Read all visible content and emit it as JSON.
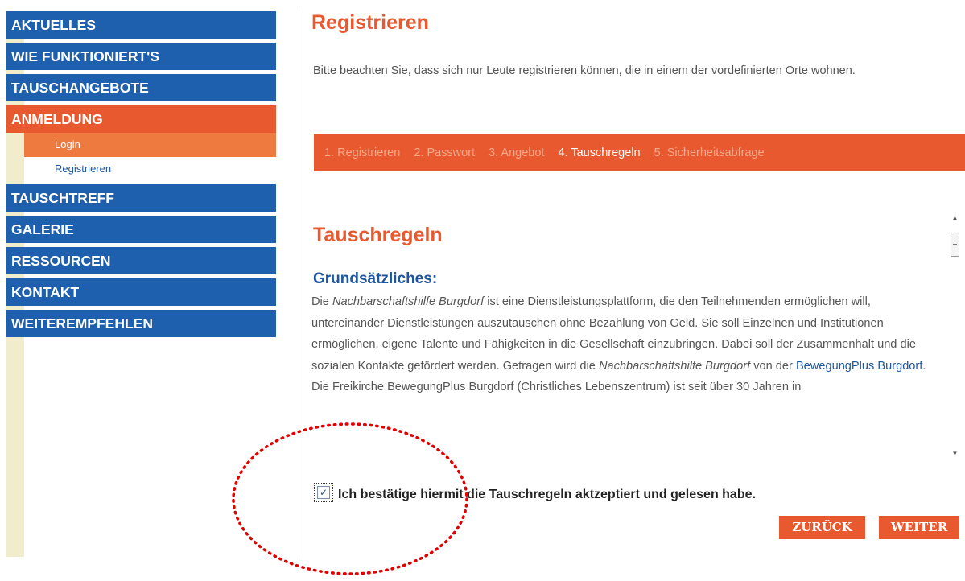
{
  "sidebar": {
    "items": [
      {
        "label": "AKTUELLES"
      },
      {
        "label": "WIE FUNKTIONIERT'S"
      },
      {
        "label": "TAUSCHANGEBOTE"
      },
      {
        "label": "ANMELDUNG"
      },
      {
        "label": "TAUSCHTREFF"
      },
      {
        "label": "GALERIE"
      },
      {
        "label": "RESSOURCEN"
      },
      {
        "label": "KONTAKT"
      },
      {
        "label": "WEITEREMPFEHLEN"
      }
    ],
    "subitems": [
      {
        "label": "Login"
      },
      {
        "label": "Registrieren"
      }
    ]
  },
  "main": {
    "title": "Registrieren",
    "intro": "Bitte beachten Sie, dass sich nur Leute registrieren können, die in einem der vordefinierten Orte wohnen.",
    "steps": [
      {
        "label": "1. Registrieren"
      },
      {
        "label": "2. Passwort"
      },
      {
        "label": "3. Angebot"
      },
      {
        "label": "4. Tauschregeln"
      },
      {
        "label": "5. Sicherheitsabfrage"
      }
    ]
  },
  "rules": {
    "heading": "Tauschregeln",
    "subheading": "Grundsätzliches:",
    "p1": "Die ",
    "p1_em": "Nachbarschaftshilfe Burgdorf",
    "p2": " ist eine Dienstleistungsplattform, die den Teilnehmenden ermöglichen will, untereinander Dienstleistungen auszutauschen ohne Bezahlung von Geld. Sie soll Einzelnen und Institutionen ermöglichen, eigene Talente und Fähigkeiten in die Gesellschaft einzubringen. Dabei soll der Zusammenhalt und die sozialen Kontakte gefördert werden. Getragen wird die ",
    "p2_em": "Nachbarschaftshilfe Burgdorf",
    "p3": " von der ",
    "link": "BewegungPlus Burgdorf",
    "p4": ". Die Freikirche BewegungPlus Burgdorf (Christliches Lebenszentrum) ist seit über 30 Jahren in"
  },
  "scrollbar": {
    "up_icon": "▲",
    "down_icon": "▼"
  },
  "confirm": {
    "checked": true,
    "check_mark": "✓",
    "label": "Ich bestätige hiermit die Tauschregeln aktzeptiert und gelesen habe."
  },
  "buttons": {
    "back": "ZURÜCK",
    "next": "WEITER"
  },
  "colors": {
    "nav_blue": "#1e60ae",
    "accent_orange": "#e9592f",
    "annotation_red": "#e00000"
  }
}
